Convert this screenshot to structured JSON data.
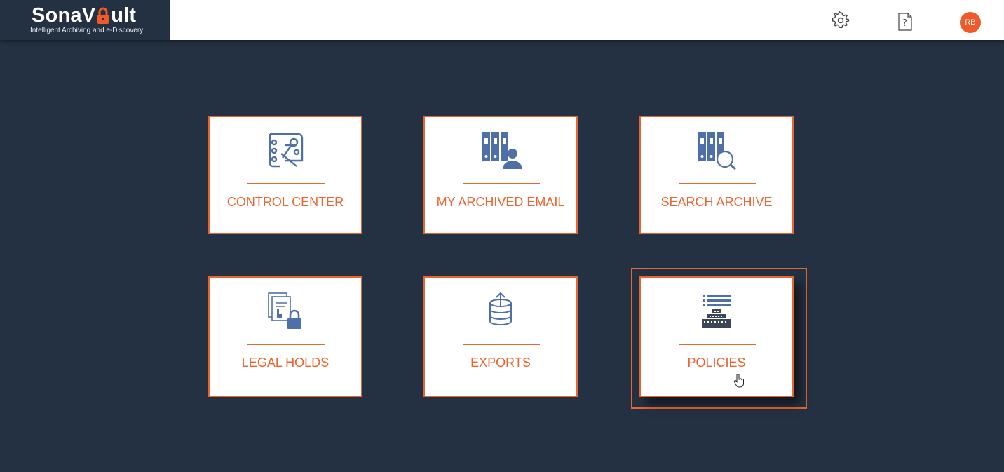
{
  "brand": {
    "name_part1": "SonaV",
    "name_part2": "ult",
    "tagline": "Intelligent Archiving and e-Discovery"
  },
  "header": {
    "settings_icon": "gear-icon",
    "help_icon": "help-document-icon",
    "avatar_initials": "RB"
  },
  "colors": {
    "background": "#243142",
    "accent": "#e9642e",
    "icon_blue": "#4f6fa8",
    "avatar": "#ef5a28"
  },
  "tiles": [
    {
      "label": "CONTROL CENTER",
      "icon": "control-center-icon"
    },
    {
      "label": "MY ARCHIVED EMAIL",
      "icon": "archived-email-icon"
    },
    {
      "label": "SEARCH ARCHIVE",
      "icon": "search-archive-icon"
    },
    {
      "label": "LEGAL HOLDS",
      "icon": "legal-holds-icon"
    },
    {
      "label": "EXPORTS",
      "icon": "exports-icon"
    },
    {
      "label": "POLICIES",
      "icon": "policies-icon"
    }
  ]
}
